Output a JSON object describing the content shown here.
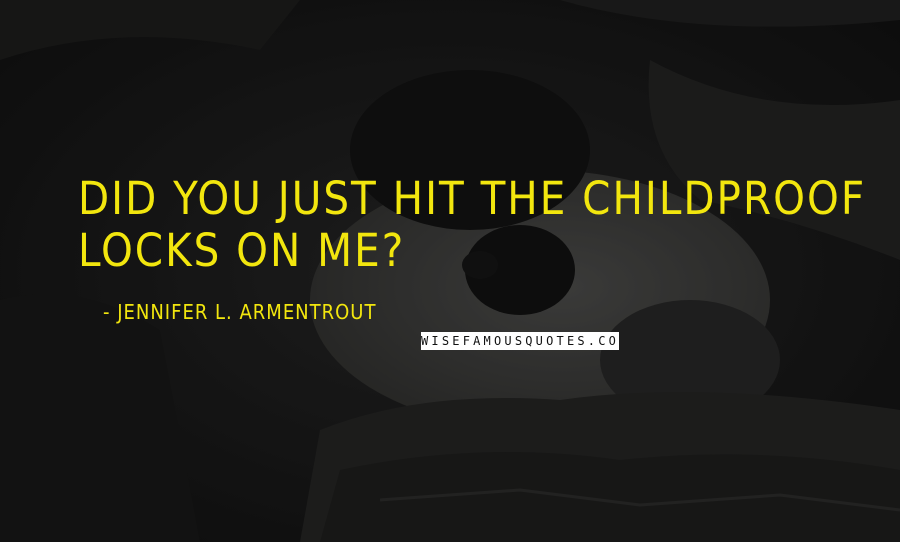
{
  "quote": {
    "text": "Did you just hit the childproof locks on me?"
  },
  "author": {
    "name": "Jennifer L. Armentrout"
  },
  "watermark": {
    "text": "WISEFAMOUSQUOTES.COM"
  },
  "colors": {
    "quote_text": "#f2e60e",
    "background": "#1a1a1a",
    "watermark_bg": "#ffffff",
    "watermark_text": "#111111"
  },
  "background_image": {
    "subject": "panda resting on rocks",
    "icon": "panda-photo"
  }
}
